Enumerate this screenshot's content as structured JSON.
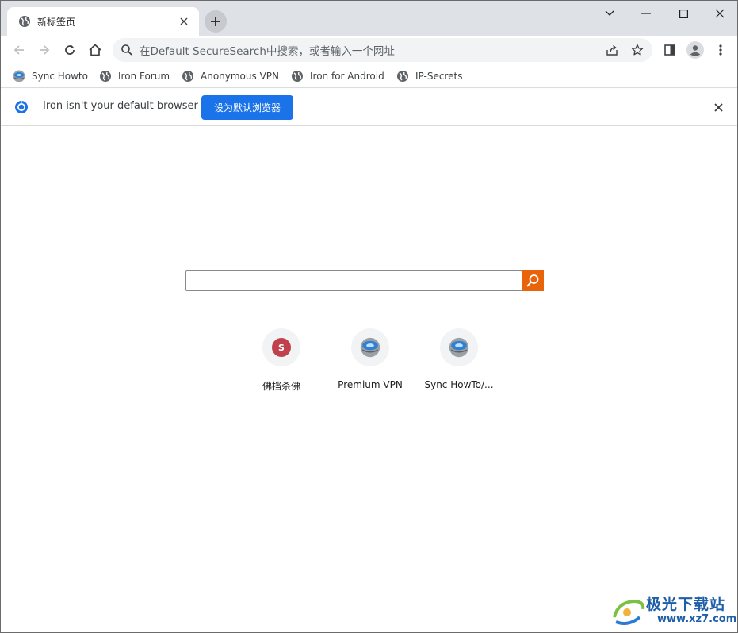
{
  "tab": {
    "title": "新标签页"
  },
  "omnibox": {
    "placeholder": "在Default SecureSearch中搜索，或者输入一个网址"
  },
  "bookmarks": [
    {
      "label": "Sync Howto",
      "icon": "iron-logo-icon"
    },
    {
      "label": "Iron Forum",
      "icon": "globe-icon"
    },
    {
      "label": "Anonymous VPN",
      "icon": "globe-icon"
    },
    {
      "label": "Iron for Android",
      "icon": "globe-icon"
    },
    {
      "label": "IP-Secrets",
      "icon": "globe-icon"
    }
  ],
  "infobar": {
    "message": "Iron isn't your default browser",
    "button_label": "设为默认浏览器"
  },
  "tiles": [
    {
      "label": "佛挡杀佛",
      "badge": "S",
      "icon": "letter-icon"
    },
    {
      "label": "Premium VPN",
      "icon": "iron-logo-icon"
    },
    {
      "label": "Sync HowTo/...",
      "icon": "iron-logo-icon"
    }
  ],
  "watermark": {
    "brand": "极光下载站",
    "url": "www.xz7.com"
  },
  "colors": {
    "accent": "#1a73e8",
    "search_button": "#e8630a",
    "tile_badge": "#c0414b",
    "tabstrip": "#dee1e6"
  }
}
